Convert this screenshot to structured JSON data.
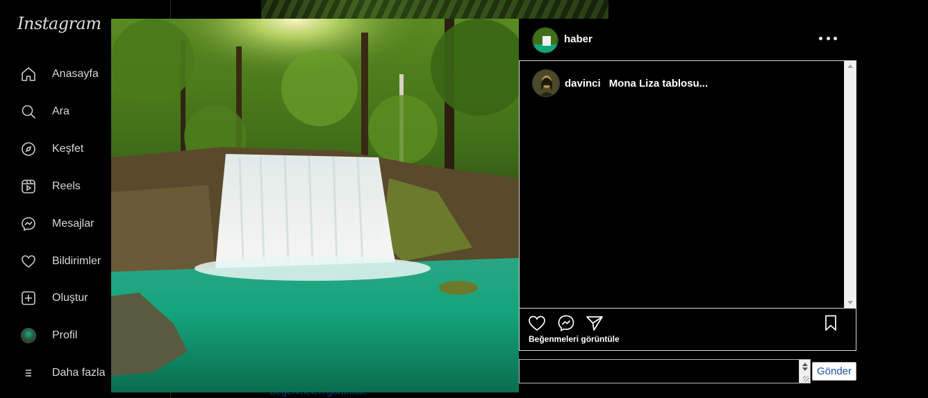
{
  "app": {
    "logo_text": "Instagram"
  },
  "sidebar": {
    "items": [
      {
        "label": "Anasayfa",
        "icon": "home-icon"
      },
      {
        "label": "Ara",
        "icon": "search-icon"
      },
      {
        "label": "Keşfet",
        "icon": "compass-icon"
      },
      {
        "label": "Reels",
        "icon": "reels-icon"
      },
      {
        "label": "Mesajlar",
        "icon": "messenger-icon"
      },
      {
        "label": "Bildirimler",
        "icon": "heart-icon"
      },
      {
        "label": "Oluştur",
        "icon": "plus-square-icon"
      },
      {
        "label": "Profil",
        "icon": "profile-avatar"
      },
      {
        "label": "Daha fazla",
        "icon": "menu-icon"
      }
    ]
  },
  "post": {
    "username": "haber",
    "image": "waterfall-photo",
    "more_icon": "more-horizontal-icon",
    "comments": [
      {
        "username": "davinci",
        "text": "Mona Liza tablosu..."
      }
    ],
    "actions": {
      "like_icon": "heart-icon",
      "share_icon": "messenger-icon",
      "send_icon": "paper-plane-icon",
      "save_icon": "bookmark-icon"
    },
    "likes_link": "Beğenmeleri görüntüle",
    "comment_input_value": "",
    "send_button": "Gönder"
  },
  "background": {
    "ghost_text": "Beğenmeleri görüntüle"
  },
  "colors": {
    "background": "#000000",
    "link_blue": "#1a55a8",
    "border": "#dcdcdc"
  }
}
